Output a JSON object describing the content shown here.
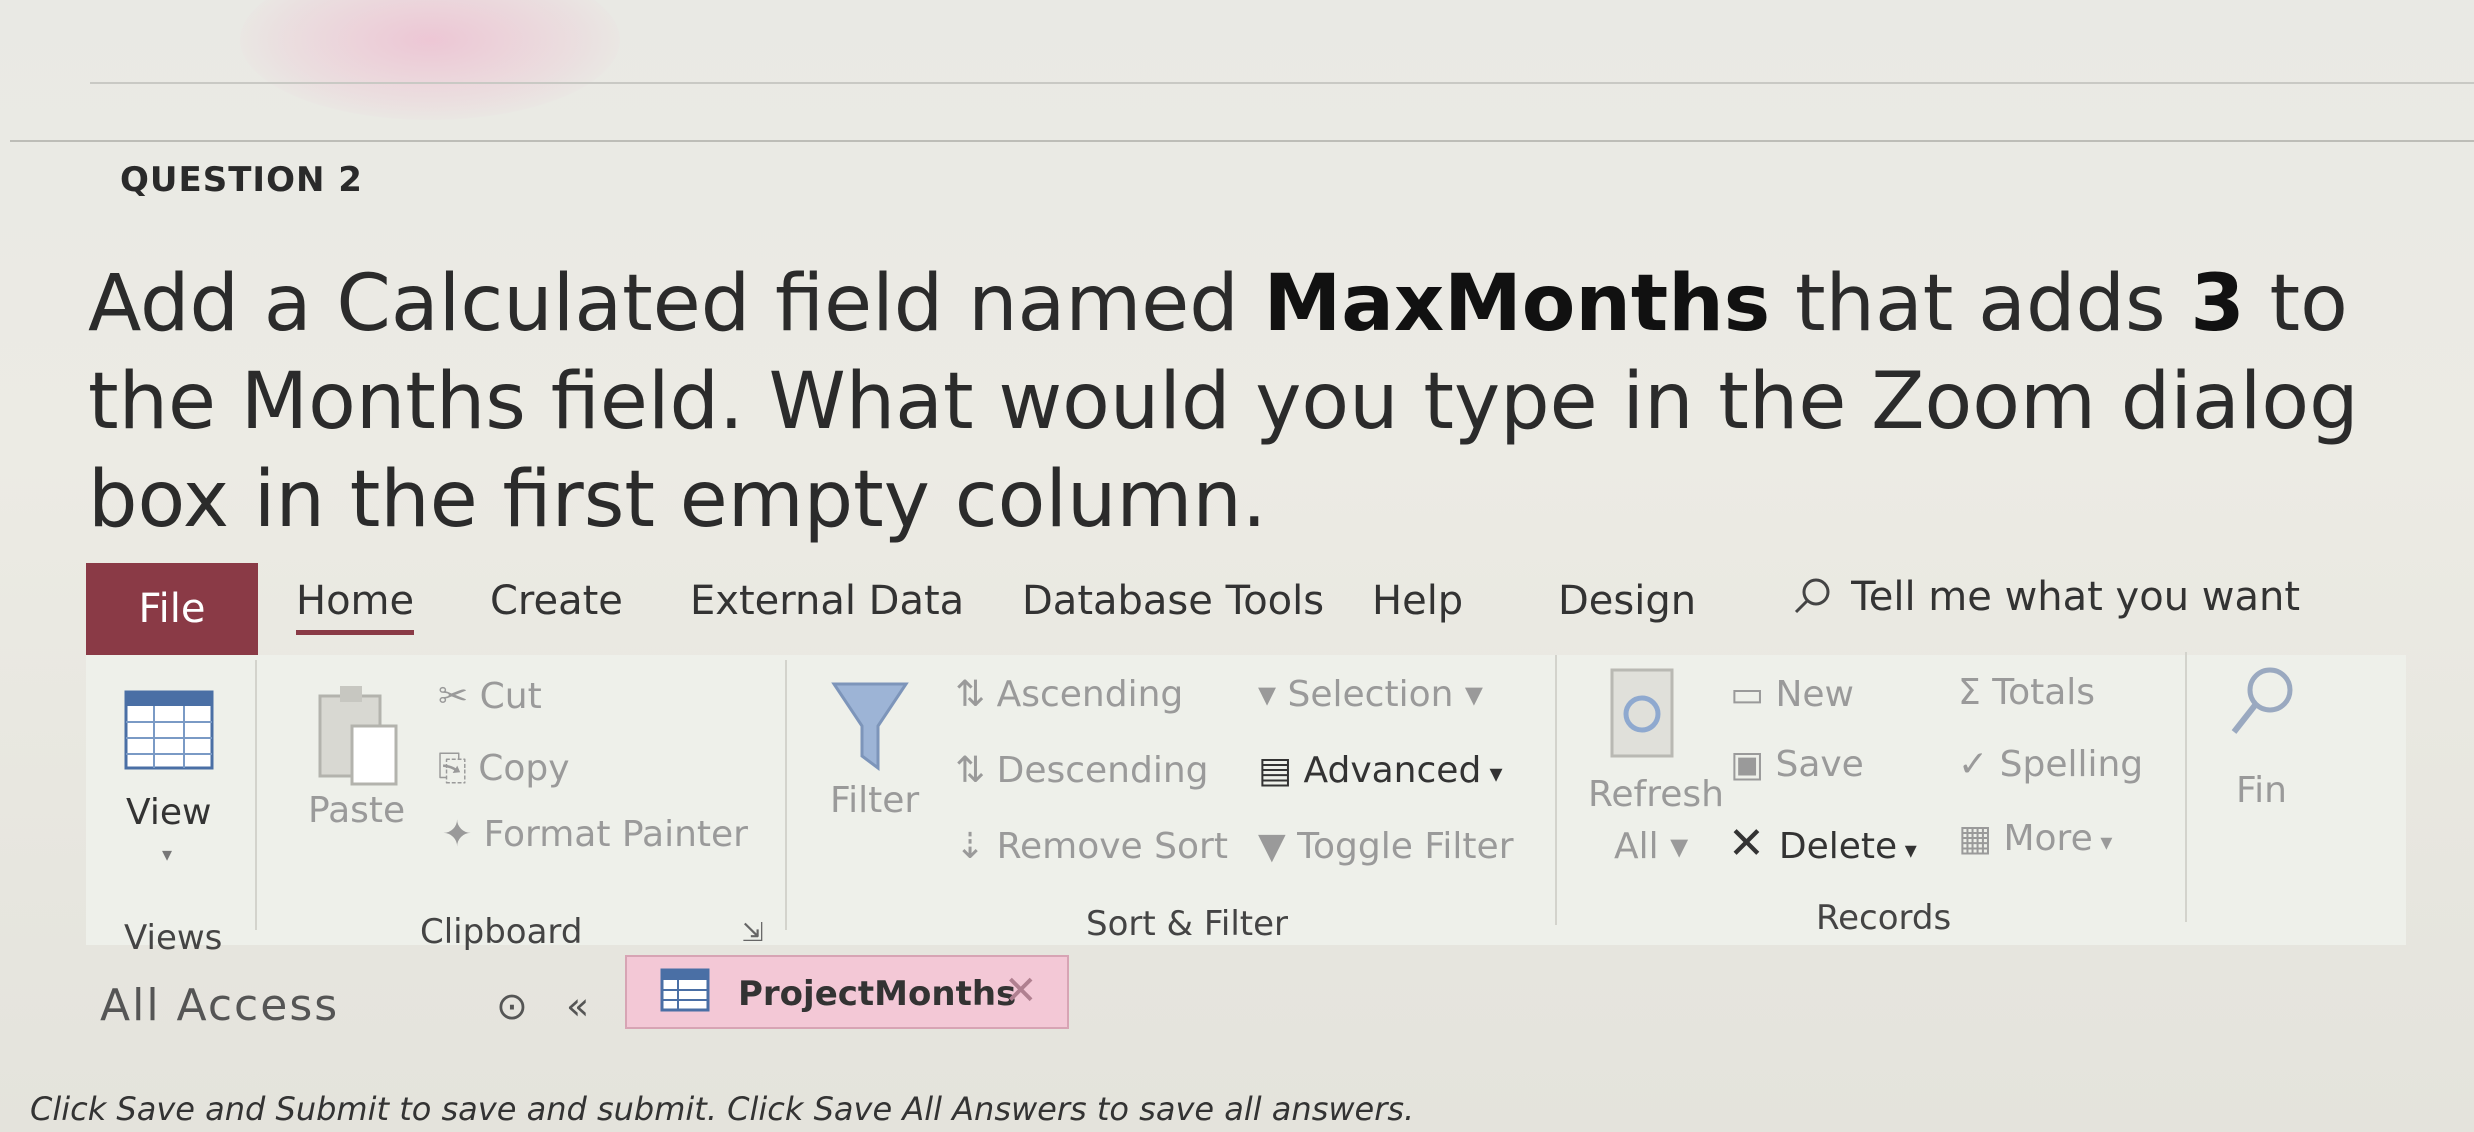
{
  "question": {
    "label": "QUESTION 2",
    "text_part1": "Add a Calculated field named ",
    "field_name": "MaxMonths",
    "text_part2": " that adds ",
    "number": "3",
    "text_part3": " to the Months field. What would you type in the Zoom dialog box in the first empty column."
  },
  "ribbon": {
    "tabs": [
      "File",
      "Home",
      "Create",
      "External Data",
      "Database Tools",
      "Help",
      "Design"
    ],
    "tell_me": "Tell me what you want",
    "views": {
      "view_label": "View",
      "group_label": "Views"
    },
    "clipboard": {
      "paste": "Paste",
      "cut": "Cut",
      "copy": "Copy",
      "format_painter": "Format Painter",
      "group_label": "Clipboard"
    },
    "sort_filter": {
      "filter": "Filter",
      "ascending": "Ascending",
      "descending": "Descending",
      "remove_sort": "Remove Sort",
      "selection": "Selection",
      "advanced": "Advanced",
      "toggle_filter": "Toggle Filter",
      "group_label": "Sort & Filter"
    },
    "records": {
      "refresh": "Refresh",
      "refresh_all": "All",
      "new": "New",
      "save": "Save",
      "delete": "Delete",
      "totals": "Totals",
      "spelling": "Spelling",
      "more": "More",
      "group_label": "Records"
    },
    "find": "Fin"
  },
  "nav_pane": {
    "title": "All Access"
  },
  "document_tab": {
    "label": "ProjectMonths"
  },
  "footer": "Click Save and Submit to save and submit. Click Save All Answers to save all answers.",
  "colors": {
    "file_tab": "#8a3a46",
    "doc_tab": "#f3c8d6"
  }
}
